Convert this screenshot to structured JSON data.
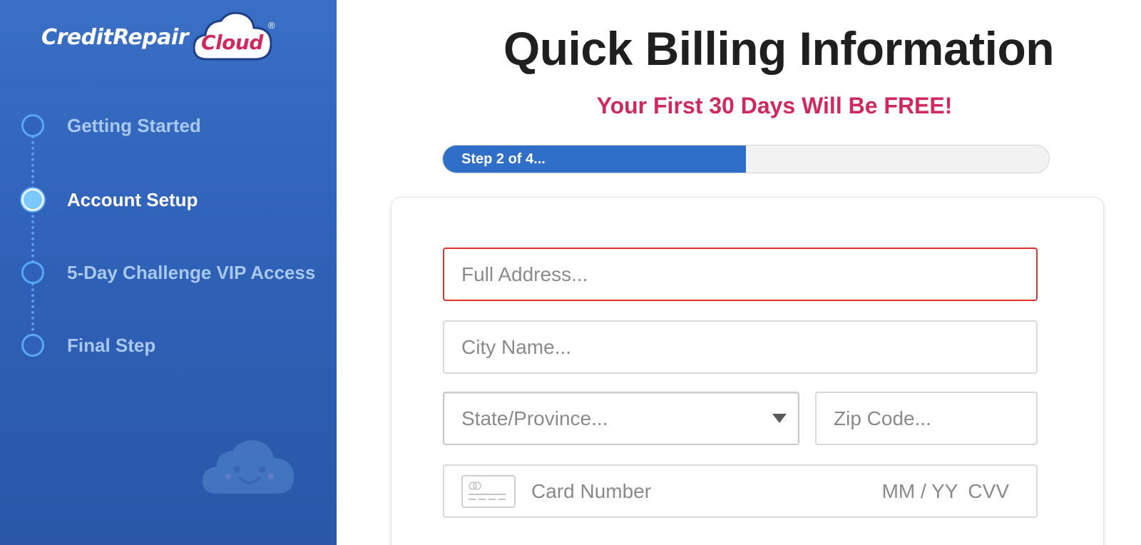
{
  "brand": {
    "name_part1": "CreditRepair",
    "name_part2": "Cloud",
    "registered": "®",
    "accent_color": "#cf2a5f",
    "sidebar_color": "#2f62b8"
  },
  "sidebar": {
    "steps": [
      {
        "label": "Getting Started",
        "state": "inactive"
      },
      {
        "label": "Account Setup",
        "state": "active"
      },
      {
        "label": "5-Day Challenge VIP Access",
        "state": "inactive"
      },
      {
        "label": "Final Step",
        "state": "inactive"
      }
    ]
  },
  "header": {
    "title": "Quick Billing Information",
    "subtitle": "Your First 30 Days Will Be FREE!"
  },
  "progress": {
    "label": "Step 2 of 4...",
    "fraction": 0.5
  },
  "form": {
    "address_placeholder": "Full Address...",
    "city_placeholder": "City Name...",
    "state_selected": "State/Province...",
    "zip_placeholder": "Zip Code...",
    "card": {
      "number_label": "Card Number",
      "expiry_label": "MM / YY",
      "cvv_label": "CVV",
      "icon": "credit-card-icon"
    }
  }
}
